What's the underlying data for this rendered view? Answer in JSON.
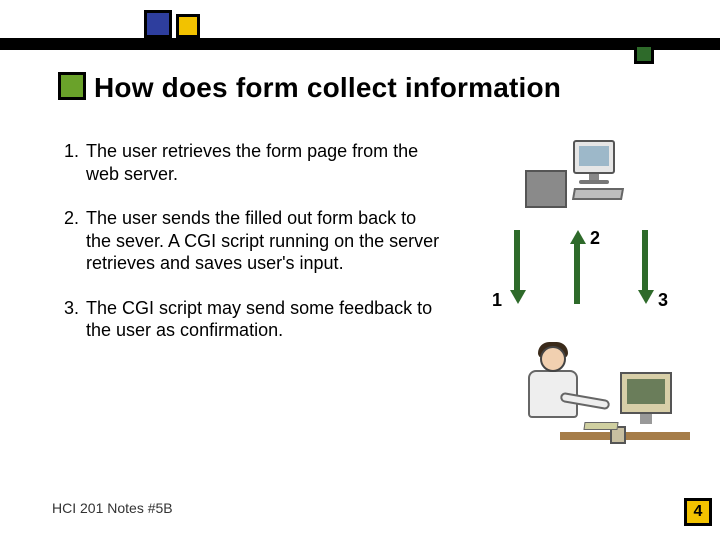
{
  "title": "How does form collect information",
  "items": [
    {
      "n": "1.",
      "text": "The user retrieves the form page from the web server."
    },
    {
      "n": "2.",
      "text": "The user sends the filled out form back to the sever. A CGI script running on the server retrieves and saves user's input."
    },
    {
      "n": "3.",
      "text": "The CGI script may send some feedback to the user as confirmation."
    }
  ],
  "arrows": {
    "left": "1",
    "mid": "2",
    "right": "3"
  },
  "footer": "HCI 201 Notes #5B",
  "page": "4"
}
